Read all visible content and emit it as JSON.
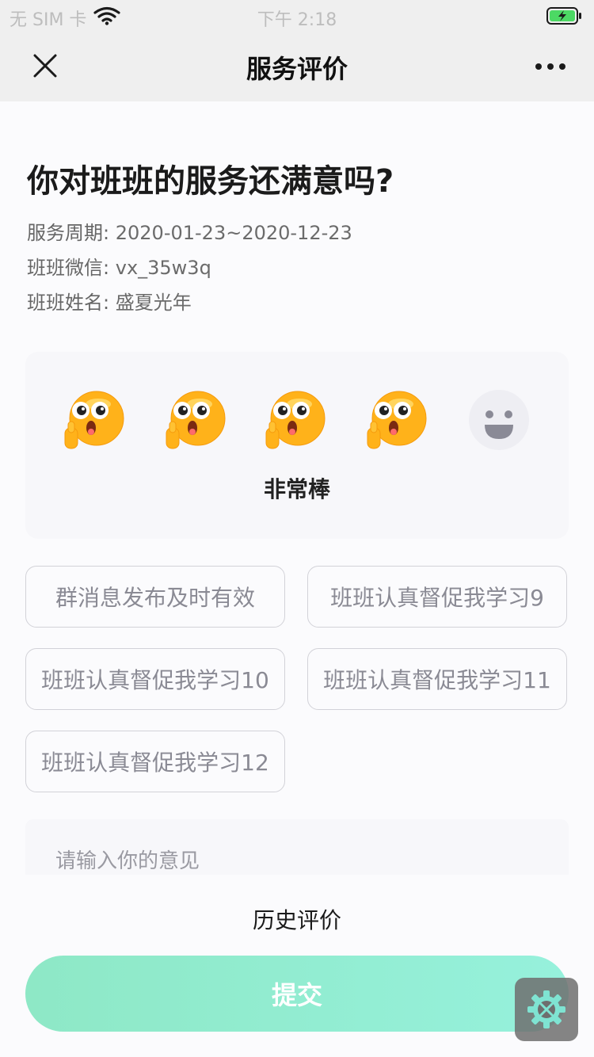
{
  "status_bar": {
    "carrier": "无 SIM 卡",
    "time": "下午 2:18"
  },
  "nav": {
    "title": "服务评价"
  },
  "question": "你对班班的服务还满意吗?",
  "info": {
    "period_label": "服务周期:",
    "period_value": "2020-01-23~2020-12-23",
    "wechat_label": "班班微信:",
    "wechat_value": "vx_35w3q",
    "name_label": "班班姓名:",
    "name_value": "盛夏光年"
  },
  "rating": {
    "value": 4,
    "max": 5,
    "label": "非常棒"
  },
  "tags": [
    "群消息发布及时有效",
    "班班认真督促我学习9",
    "班班认真督促我学习10",
    "班班认真督促我学习11",
    "班班认真督促我学习12"
  ],
  "opinion": {
    "placeholder": "请输入你的意见"
  },
  "history_link": "历史评价",
  "submit_label": "提交",
  "colors": {
    "accent": "#8ee8c6",
    "emoji_active": "#ffb21a",
    "emoji_inactive": "#eeeef3"
  }
}
